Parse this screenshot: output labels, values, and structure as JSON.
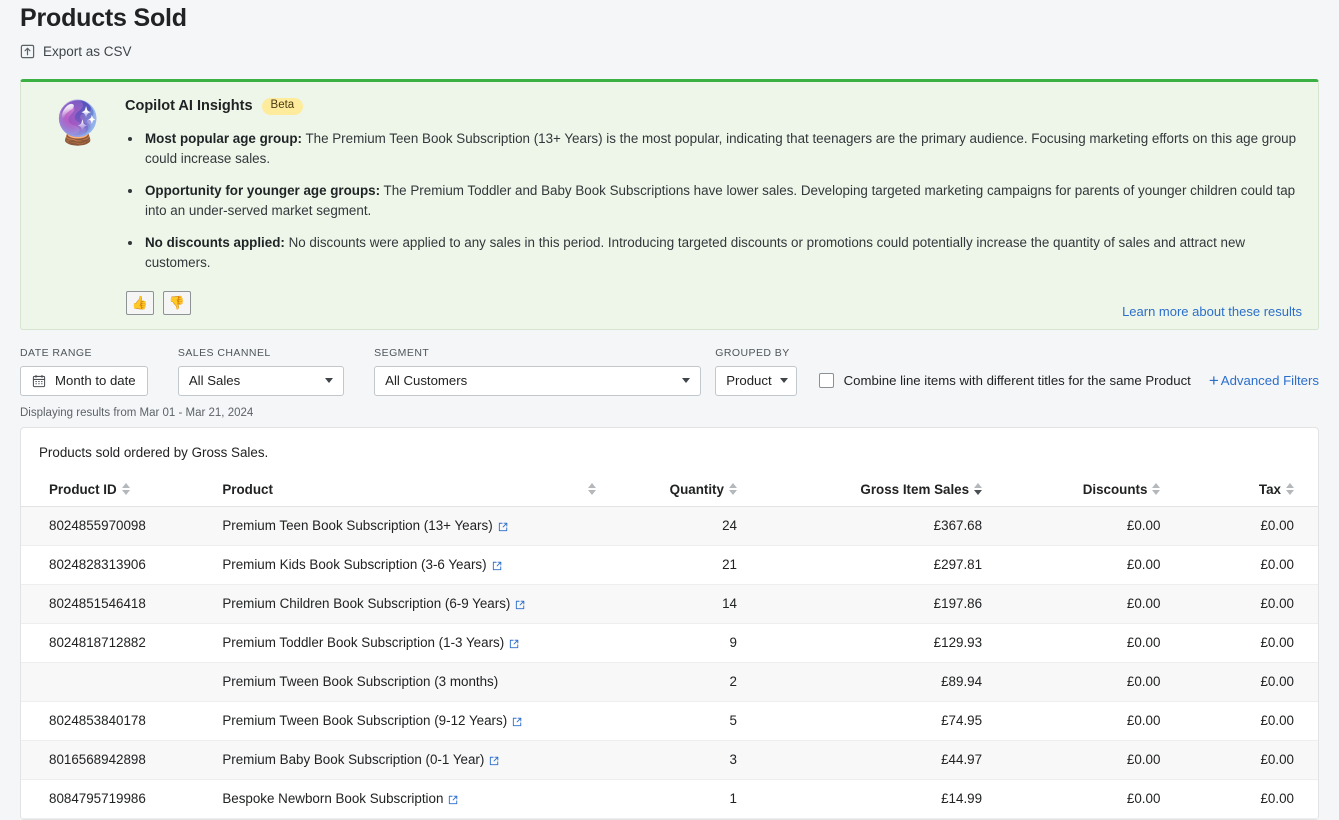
{
  "page": {
    "title": "Products Sold",
    "export_label": "Export as CSV",
    "export_icon": "export-icon"
  },
  "insights": {
    "icon": "crystal-ball-icon",
    "title": "Copilot AI Insights",
    "badge": "Beta",
    "accent_color": "#3bb143",
    "background_color": "#eef6e9",
    "badge_color": "#ffeb9c",
    "bullets": [
      {
        "lead": "Most popular age group:",
        "text": " The Premium Teen Book Subscription (13+ Years) is the most popular, indicating that teenagers are the primary audience. Focusing marketing efforts on this age group could increase sales."
      },
      {
        "lead": "Opportunity for younger age groups:",
        "text": " The Premium Toddler and Baby Book Subscriptions have lower sales. Developing targeted marketing campaigns for parents of younger children could tap into an under-served market segment."
      },
      {
        "lead": "No discounts applied:",
        "text": " No discounts were applied to any sales in this period. Introducing targeted discounts or promotions could potentially increase the quantity of sales and attract new customers."
      }
    ],
    "thumbs_up": "👍",
    "thumbs_down": "👎",
    "learn_more": "Learn more about these results"
  },
  "filters": {
    "date_range": {
      "label": "DATE RANGE",
      "value": "Month to date",
      "icon": "calendar-icon"
    },
    "sales_channel": {
      "label": "SALES CHANNEL",
      "value": "All Sales"
    },
    "segment": {
      "label": "SEGMENT",
      "value": "All Customers"
    },
    "grouped_by": {
      "label": "GROUPED BY",
      "value": "Product"
    },
    "combine_checkbox": {
      "label": "Combine line items with different titles for the same Product",
      "checked": false
    },
    "advanced_filters": {
      "label": "Advanced Filters",
      "icon": "plus-icon"
    }
  },
  "results_note": "Displaying results from Mar 01 - Mar 21, 2024",
  "table": {
    "caption": "Products sold ordered by Gross Sales.",
    "sorted_by": "Gross Item Sales",
    "sort_direction": "desc",
    "columns": [
      {
        "key": "product_id",
        "label": "Product ID",
        "align": "left",
        "sortable": true
      },
      {
        "key": "product",
        "label": "Product",
        "align": "left",
        "sortable": true
      },
      {
        "key": "quantity",
        "label": "Quantity",
        "align": "right",
        "sortable": true
      },
      {
        "key": "gross_item_sales",
        "label": "Gross Item Sales",
        "align": "right",
        "sortable": true
      },
      {
        "key": "discounts",
        "label": "Discounts",
        "align": "right",
        "sortable": true
      },
      {
        "key": "tax",
        "label": "Tax",
        "align": "right",
        "sortable": true
      }
    ],
    "rows": [
      {
        "product_id": "8024855970098",
        "product": "Premium Teen Book Subscription (13+ Years)",
        "has_link": true,
        "quantity": "24",
        "gross_item_sales": "£367.68",
        "discounts": "£0.00",
        "tax": "£0.00"
      },
      {
        "product_id": "8024828313906",
        "product": "Premium Kids Book Subscription (3-6 Years)",
        "has_link": true,
        "quantity": "21",
        "gross_item_sales": "£297.81",
        "discounts": "£0.00",
        "tax": "£0.00"
      },
      {
        "product_id": "8024851546418",
        "product": "Premium Children Book Subscription (6-9 Years)",
        "has_link": true,
        "quantity": "14",
        "gross_item_sales": "£197.86",
        "discounts": "£0.00",
        "tax": "£0.00"
      },
      {
        "product_id": "8024818712882",
        "product": "Premium Toddler Book Subscription (1-3 Years)",
        "has_link": true,
        "quantity": "9",
        "gross_item_sales": "£129.93",
        "discounts": "£0.00",
        "tax": "£0.00"
      },
      {
        "product_id": "",
        "product": "Premium Tween Book Subscription (3 months)",
        "has_link": false,
        "quantity": "2",
        "gross_item_sales": "£89.94",
        "discounts": "£0.00",
        "tax": "£0.00"
      },
      {
        "product_id": "8024853840178",
        "product": "Premium Tween Book Subscription (9-12 Years)",
        "has_link": true,
        "quantity": "5",
        "gross_item_sales": "£74.95",
        "discounts": "£0.00",
        "tax": "£0.00"
      },
      {
        "product_id": "8016568942898",
        "product": "Premium Baby Book Subscription (0-1 Year)",
        "has_link": true,
        "quantity": "3",
        "gross_item_sales": "£44.97",
        "discounts": "£0.00",
        "tax": "£0.00"
      },
      {
        "product_id": "8084795719986",
        "product": "Bespoke Newborn Book Subscription",
        "has_link": true,
        "quantity": "1",
        "gross_item_sales": "£14.99",
        "discounts": "£0.00",
        "tax": "£0.00"
      }
    ]
  }
}
